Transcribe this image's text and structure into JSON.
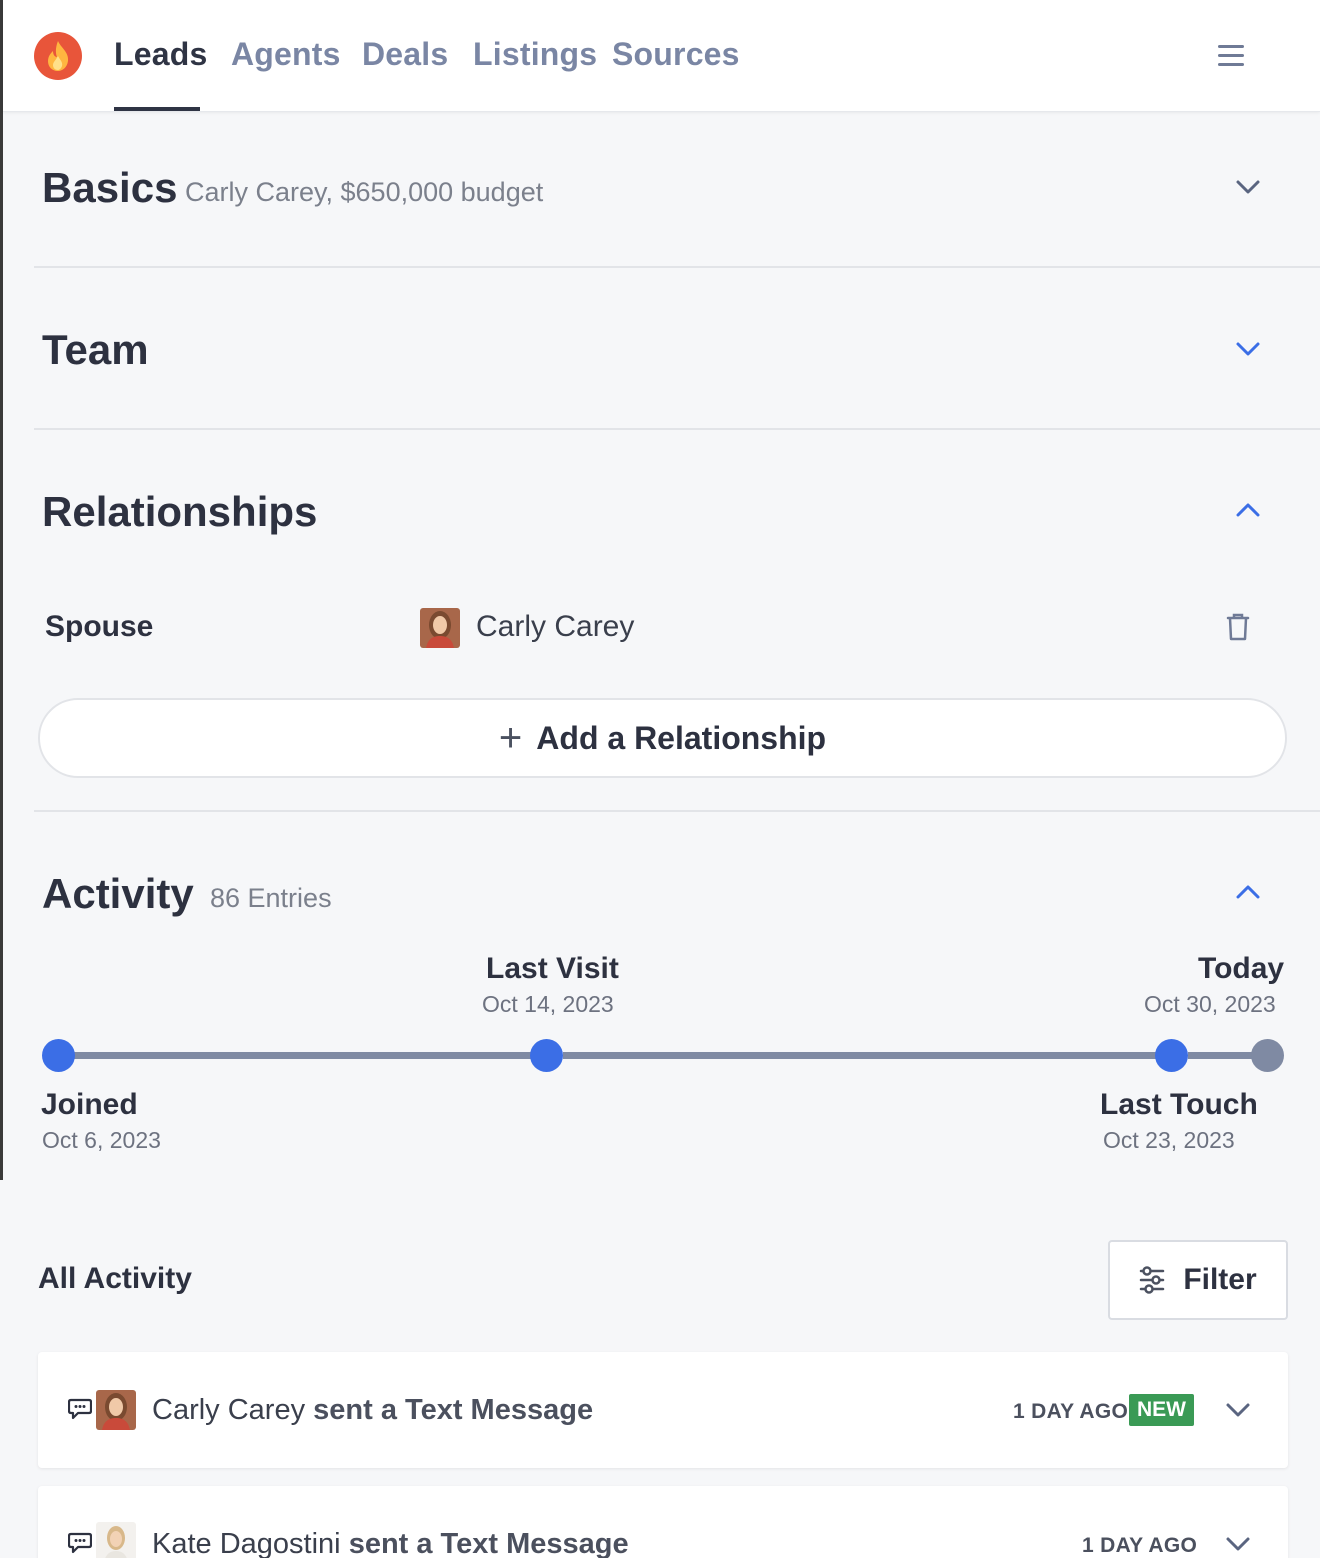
{
  "nav": {
    "items": [
      {
        "label": "Leads",
        "active": true
      },
      {
        "label": "Agents",
        "active": false
      },
      {
        "label": "Deals",
        "active": false
      },
      {
        "label": "Listings",
        "active": false
      },
      {
        "label": "Sources",
        "active": false
      }
    ],
    "logo_icon": "fire-icon",
    "menu_icon": "hamburger-menu-icon"
  },
  "basics": {
    "title": "Basics",
    "summary": "Carly Carey, $650,000 budget"
  },
  "team": {
    "title": "Team"
  },
  "relationships": {
    "title": "Relationships",
    "items": [
      {
        "type": "Spouse",
        "name": "Carly Carey"
      }
    ],
    "add_label": "Add a Relationship"
  },
  "activity": {
    "title": "Activity",
    "count": "86 Entries",
    "timeline": {
      "joined": {
        "label": "Joined",
        "date": "Oct 6, 2023"
      },
      "last_visit": {
        "label": "Last Visit",
        "date": "Oct 14, 2023"
      },
      "last_touch": {
        "label": "Last Touch",
        "date": "Oct 23, 2023"
      },
      "today": {
        "label": "Today",
        "date": "Oct 30, 2023"
      }
    },
    "all_label": "All Activity",
    "filter_label": "Filter",
    "entries": [
      {
        "actor": "Carly Carey",
        "action": "sent a Text Message",
        "ago": "1 DAY AGO",
        "badge": "NEW"
      },
      {
        "actor": "Kate Dagostini",
        "action": "sent a Text Message",
        "ago": "1 DAY AGO",
        "badge": ""
      }
    ]
  },
  "colors": {
    "accent": "#3b6ee6",
    "logo": "#e8553a",
    "new_badge": "#3a9a55",
    "timeline_grey": "#7f8aa3"
  }
}
